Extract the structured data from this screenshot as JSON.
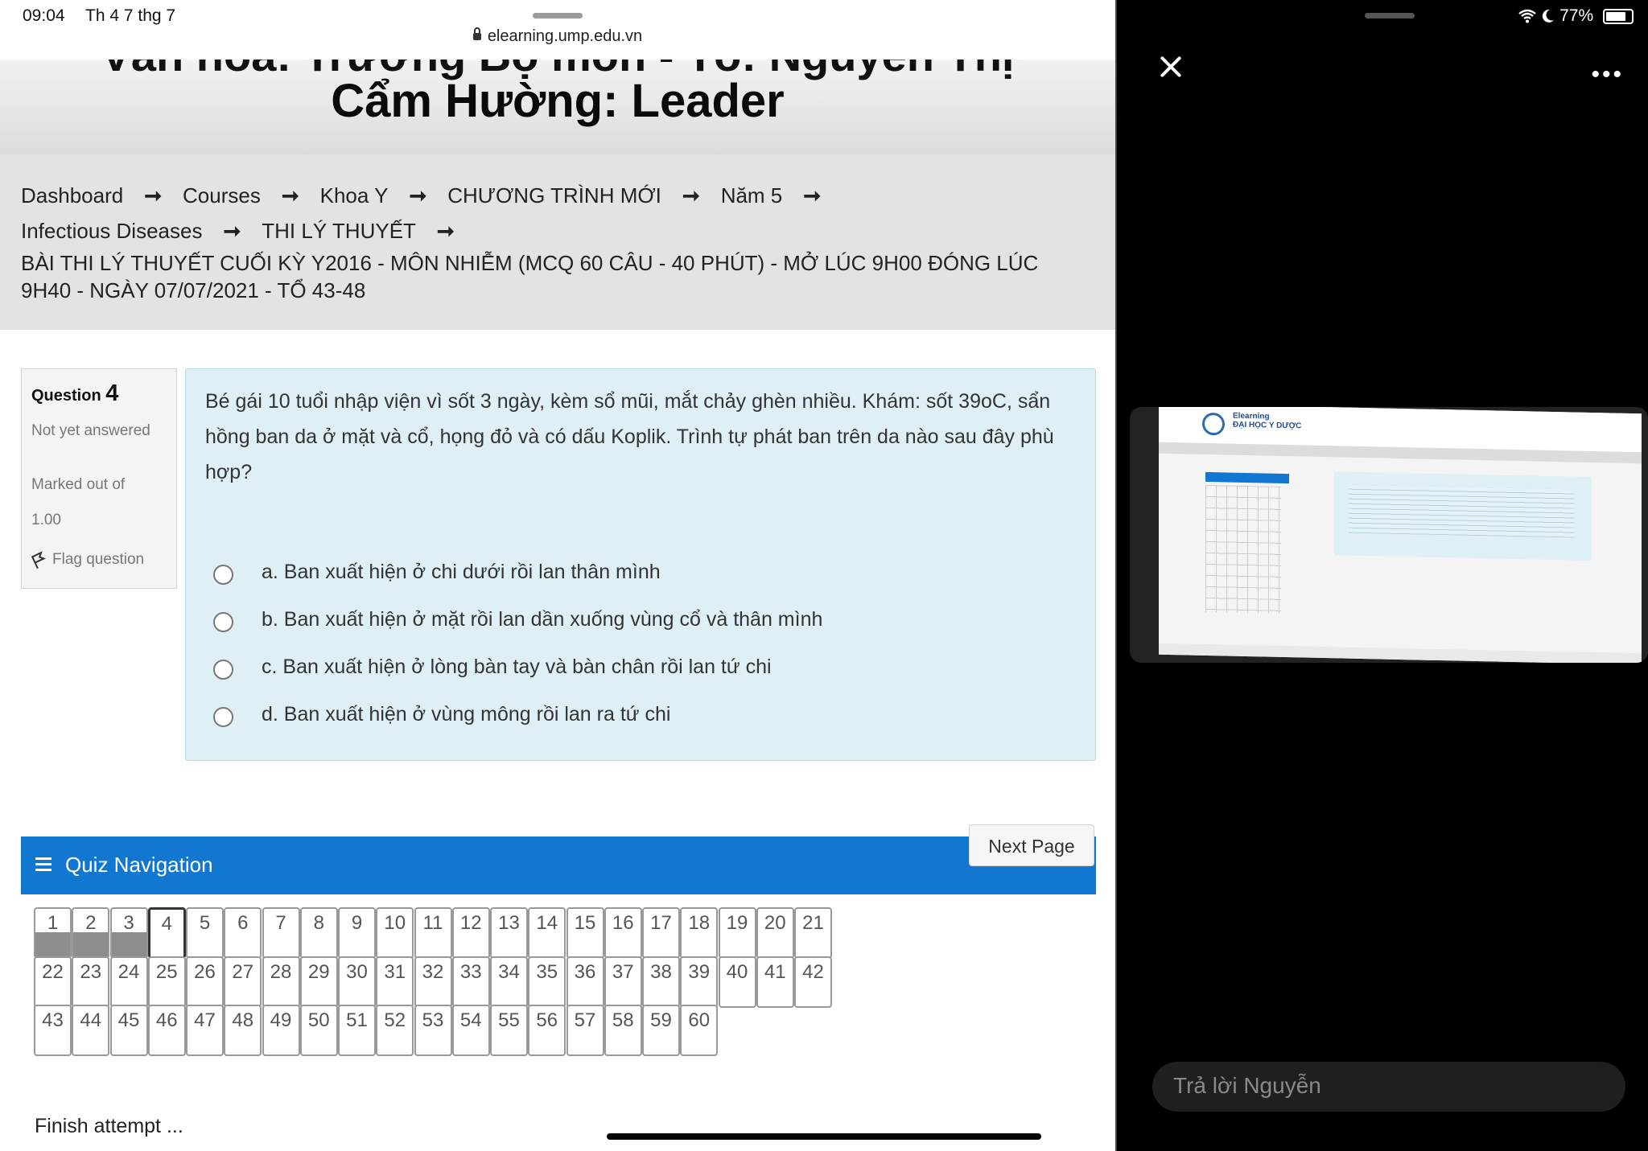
{
  "status_bar": {
    "time": "09:04",
    "date": "Th 4 7 thg 7",
    "url": "elearning.ump.edu.vn",
    "battery": "77%"
  },
  "banner": {
    "partial_line": "Văn hóa: Trường Bộ môn - Tổ: Nguyễn Thị",
    "title": "Cẩm Hường: Leader"
  },
  "breadcrumb": {
    "row1": [
      "Dashboard",
      "Courses",
      "Khoa Y",
      "CHƯƠNG TRÌNH MỚI",
      "Năm 5"
    ],
    "row2": [
      "Infectious Diseases",
      "THI LÝ THUYẾT"
    ],
    "arrow": "➞",
    "exam_title": "BÀI THI LÝ THUYẾT CUỐI KỲ Y2016 - MÔN NHIỄM (MCQ 60 CÂU - 40 PHÚT) - MỞ LÚC 9H00 ĐÓNG LÚC 9H40 - NGÀY 07/07/2021 - TỔ 43-48"
  },
  "question_info": {
    "label": "Question",
    "number": "4",
    "status": "Not yet answered",
    "marked_label": "Marked out of",
    "marked_value": "1.00",
    "flag_label": "Flag question"
  },
  "question": {
    "text": "Bé gái 10 tuổi nhập viện vì sốt 3 ngày, kèm sổ mũi, mắt chảy ghèn nhiều. Khám: sốt 39oC, sẩn hồng ban da ở mặt và cổ, họng đỏ và có dấu Koplik. Trình tự phát ban trên da nào sau đây phù hợp?",
    "options": [
      "a. Ban xuất hiện ở chi dưới rồi lan thân mình",
      "b. Ban xuất hiện ở mặt rồi lan dần xuống vùng cổ và thân mình",
      "c. Ban xuất hiện ở lòng bàn tay và bàn chân rồi lan tứ chi",
      "d. Ban xuất hiện ở vùng mông rồi lan ra tứ chi"
    ]
  },
  "next_page_label": "Next Page",
  "quiz_nav": {
    "title": "Quiz Navigation",
    "answered": [
      1,
      2,
      3
    ],
    "current": 4,
    "total": 60,
    "finish_label": "Finish attempt ..."
  },
  "right_panel": {
    "more_icon": "•••",
    "reply_placeholder": "Trả lời Nguyễn",
    "photo_brand": "Elearning\nĐẠI HỌC Y DƯỢC"
  },
  "icons": [
    "lock-icon",
    "arrow-right-icon",
    "flag-icon",
    "hamburger-icon",
    "close-icon",
    "more-icon",
    "wifi-icon",
    "moon-icon",
    "battery-icon"
  ]
}
